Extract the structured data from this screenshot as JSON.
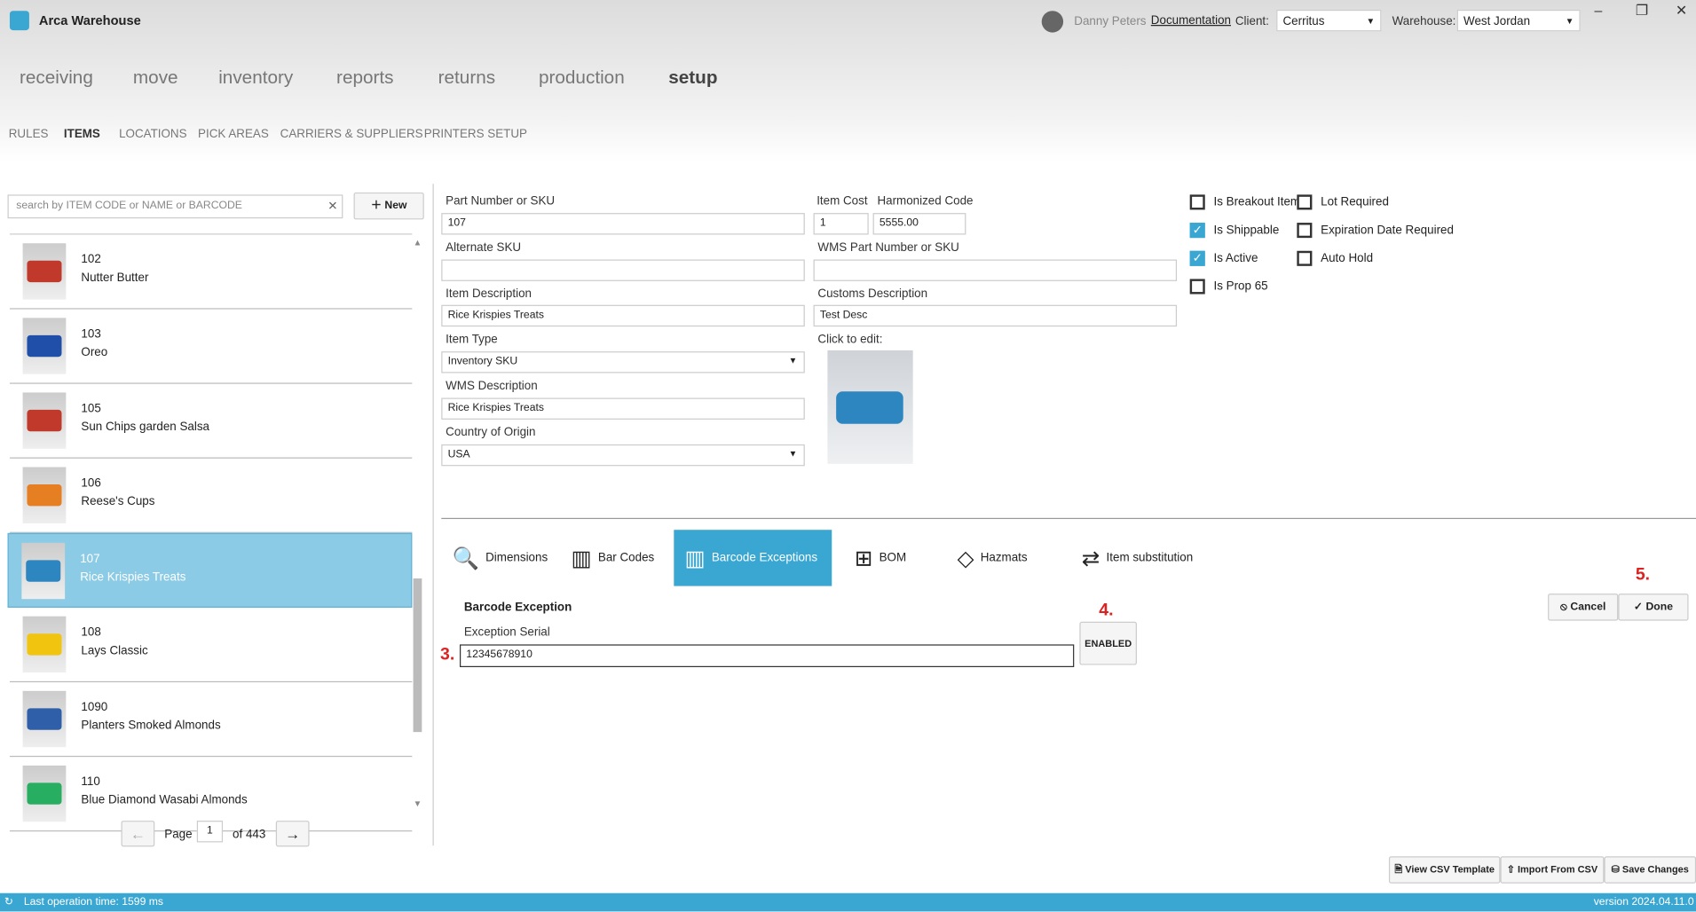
{
  "app": {
    "title": "Arca Warehouse",
    "user": "Danny Peters",
    "documentation": "Documentation",
    "client_label": "Client:",
    "client": "Cerritus",
    "warehouse_label": "Warehouse:",
    "warehouse": "West Jordan"
  },
  "nav": [
    "receiving",
    "move",
    "inventory",
    "reports",
    "returns",
    "production",
    "setup"
  ],
  "subnav": [
    "RULES",
    "ITEMS",
    "LOCATIONS",
    "PICK AREAS",
    "CARRIERS & SUPPLIERS",
    "PRINTERS SETUP"
  ],
  "search": {
    "placeholder": "search by ITEM CODE or NAME or BARCODE",
    "new_label": "New"
  },
  "items": [
    {
      "code": "102",
      "name": "Nutter Butter",
      "color": "#c0392b"
    },
    {
      "code": "103",
      "name": "Oreo",
      "color": "#1f4fa8"
    },
    {
      "code": "105",
      "name": "Sun Chips garden Salsa",
      "color": "#c0392b"
    },
    {
      "code": "106",
      "name": "Reese's Cups",
      "color": "#e67e22"
    },
    {
      "code": "107",
      "name": "Rice Krispies Treats",
      "color": "#2e86c1"
    },
    {
      "code": "108",
      "name": "Lays Classic",
      "color": "#f1c40f"
    },
    {
      "code": "1090",
      "name": "Planters Smoked Almonds",
      "color": "#2e5fa8"
    },
    {
      "code": "110",
      "name": "Blue Diamond Wasabi Almonds",
      "color": "#27ae60"
    }
  ],
  "pager": {
    "page_label": "Page",
    "page": "1",
    "of_label": "of 443"
  },
  "form": {
    "part_label": "Part Number or SKU",
    "part": "107",
    "cost_label": "Item Cost",
    "cost": "1",
    "hs_label": "Harmonized Code",
    "hs": "5555.00",
    "alt_label": "Alternate SKU",
    "alt": "",
    "wms_part_label": "WMS Part Number or SKU",
    "wms_part": "",
    "desc_label": "Item Description",
    "desc": "Rice Krispies Treats",
    "customs_label": "Customs Description",
    "customs": "Test Desc",
    "type_label": "Item Type",
    "type": "Inventory SKU",
    "click_edit": "Click to edit:",
    "wms_desc_label": "WMS Description",
    "wms_desc": "Rice Krispies Treats",
    "country_label": "Country of Origin",
    "country": "USA"
  },
  "checks": [
    {
      "label": "Is Breakout Item",
      "checked": false
    },
    {
      "label": "Is Shippable",
      "checked": true
    },
    {
      "label": "Is Active",
      "checked": true
    },
    {
      "label": "Is Prop 65",
      "checked": false
    },
    {
      "label": "Lot Required",
      "checked": false
    },
    {
      "label": "Expiration Date Required",
      "checked": false
    },
    {
      "label": "Auto Hold",
      "checked": false
    }
  ],
  "tabs": [
    "Dimensions",
    "Bar Codes",
    "Barcode Exceptions",
    "BOM",
    "Hazmats",
    "Item substitution"
  ],
  "exception": {
    "title": "Barcode Exception",
    "serial_label": "Exception Serial",
    "serial": "12345678910",
    "enabled": "ENABLED",
    "cancel": "Cancel",
    "done": "Done"
  },
  "annotations": [
    "3.",
    "4.",
    "5."
  ],
  "footer": {
    "view_csv": "View CSV Template",
    "import_csv": "Import From CSV",
    "save": "Save Changes"
  },
  "status": {
    "last_op": "Last operation time: 1599 ms",
    "version": "version 2024.04.11.0"
  }
}
